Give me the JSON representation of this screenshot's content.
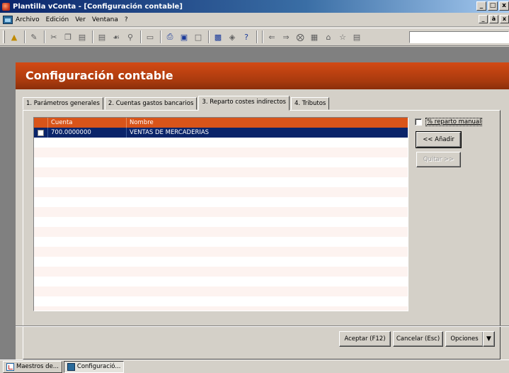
{
  "window": {
    "title": "Plantilla vConta - [Configuración contable]",
    "controls": [
      "_",
      "□",
      "x"
    ]
  },
  "menubar": {
    "items": [
      "Archivo",
      "Edición",
      "Ver",
      "Ventana",
      "?"
    ],
    "mdi_controls": [
      "_",
      "à",
      "x"
    ]
  },
  "toolbar": {
    "icons": [
      "open-folder-icon",
      "edit-icon",
      "cut-icon",
      "copy-icon",
      "paste-icon",
      "delete-icon",
      "find-icon",
      "search-icon",
      "clear-icon",
      "print-icon",
      "print-preview-icon",
      "layout-icon",
      "window-icon",
      "tag-icon",
      "help-icon",
      "back-arrow-icon",
      "forward-arrow-icon",
      "stop-icon",
      "refresh-icon",
      "home-icon",
      "favorites-icon",
      "record-icon"
    ],
    "search_value": ""
  },
  "form": {
    "title": "Configuración contable",
    "tabs": [
      {
        "label": "1. Parámetros generales",
        "selected": false
      },
      {
        "label": "2. Cuentas gastos bancarios",
        "selected": false
      },
      {
        "label": "3. Reparto costes indirectos",
        "selected": true
      },
      {
        "label": "4. Tributos",
        "selected": false
      }
    ],
    "grid": {
      "columns": [
        "Cuenta",
        "Nombre"
      ],
      "rows": [
        {
          "cuenta": "700.0000000",
          "nombre": "VENTAS DE MERCADERIAS",
          "selected": true
        }
      ]
    },
    "side": {
      "manual_label": "% reparto manual",
      "manual_checked": false,
      "add_button": "<< Añadir",
      "remove_button": "Quitar >>"
    },
    "footer": {
      "accept": "Aceptar (F12)",
      "cancel": "Cancelar (Esc)",
      "options": "Opciones",
      "options_arrow": "▼"
    }
  },
  "taskbar": {
    "items": [
      {
        "label": "Maestros de...",
        "active": false
      },
      {
        "label": "Configuració...",
        "active": true
      }
    ]
  },
  "colors": {
    "accent": "#d8541a",
    "header": "#a83a0e",
    "selection": "#0a246a",
    "title_bar": "#0a246a"
  }
}
